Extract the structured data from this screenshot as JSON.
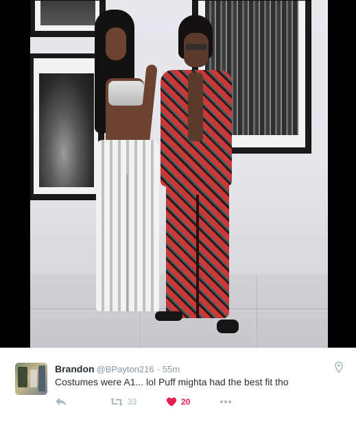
{
  "tweet": {
    "display_name": "Brandon",
    "handle": "@BPayton216",
    "separator": "·",
    "timestamp": "55m",
    "text": "Costumes were A1... lol Puff mighta had the best fit tho",
    "retweet_count": "33",
    "like_count": "20"
  },
  "icons": {
    "reply": "reply-icon",
    "retweet": "retweet-icon",
    "like": "heart-icon",
    "more": "more-icon",
    "location": "location-pin-icon"
  },
  "colors": {
    "text": "#292f33",
    "muted": "#8899a6",
    "icon": "#aab8c2",
    "like": "#e81c4f",
    "border": "#e1e8ed"
  }
}
